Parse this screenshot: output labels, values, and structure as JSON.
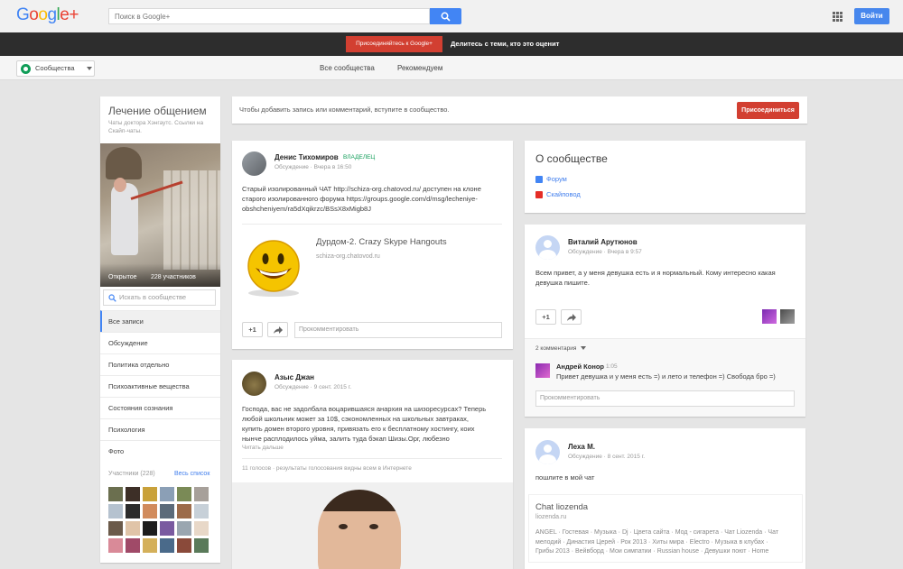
{
  "brand": {
    "name": "Google+"
  },
  "search": {
    "placeholder": "Поиск в Google+"
  },
  "header": {
    "login_label": "Войти"
  },
  "promo": {
    "join_label": "Присоединяйтесь к Google+",
    "text": "Делитесь с теми, кто это оценит"
  },
  "nav": {
    "communities_label": "Сообщества",
    "tabs": [
      {
        "label": "Все сообщества"
      },
      {
        "label": "Рекомендуем"
      }
    ]
  },
  "community": {
    "title": "Лечение общением",
    "subtitle": "Чаты доктора Хэнгаутс. Ссылки на Скайп-чаты.",
    "visibility": "Открытое",
    "members_count": "228 участников",
    "search_placeholder": "Искать в сообществе",
    "categories": [
      {
        "label": "Все записи"
      },
      {
        "label": "Обсуждение"
      },
      {
        "label": "Политика отдельно"
      },
      {
        "label": "Психоактивные вещества"
      },
      {
        "label": "Состояния сознания"
      },
      {
        "label": "Психология"
      },
      {
        "label": "Фото"
      }
    ],
    "members_header": "Участники (228)",
    "members_all": "Весь список",
    "member_colors": [
      "#6b6f4f",
      "#3d2f27",
      "#c9a13a",
      "#8b9fb6",
      "#7a8a56",
      "#a7a09a",
      "#b5c2cf",
      "#2c2c2c",
      "#d18b5c",
      "#5c6b7a",
      "#9c6b4a",
      "#c7d0d8",
      "#6b5a4a",
      "#e0c4a8",
      "#1d1d1d",
      "#7a5aa0",
      "#9aa6b0",
      "#e8d8c8",
      "#d98a98",
      "#a04a68",
      "#d4b05a",
      "#4a6a8a",
      "#8a4a3a",
      "#5a7a5a"
    ]
  },
  "joinbar": {
    "text": "Чтобы добавить запись или комментарий, вступите в сообщество.",
    "button": "Присоединиться"
  },
  "posts": {
    "p1": {
      "author": "Денис Тихомиров",
      "badge": "ВЛАДЕЛЕЦ",
      "category": "Обсуждение",
      "time": "Вчера в 16:50",
      "body_lines": [
        "Старый изолированный ЧАТ http://schiza-org.chatovod.ru/ доступен на клоне",
        "старого изолированного форума https://groups.google.com/d/msg/lecheniye-",
        "obshcheniyem/ra5dXqikrzc/BSsX8xMigb8J"
      ],
      "link_title": "Дурдом-2. Crazy Skype Hangouts",
      "link_url": "schiza-org.chatovod.ru",
      "plus": "+1",
      "comment_placeholder": "Прокомментировать"
    },
    "p2": {
      "author": "Азыс Джан",
      "category": "Обсуждение",
      "time": "9 сент. 2015 г.",
      "body_lines": [
        "Господа, вас не задолбала воцарившаяся анархия на шизоресурсах? Теперь",
        "любой школьник может за 10$, сэкономленных на школьных завтраках,",
        "купить домен второго уровня, привязать его к бесплатному хостингу, коих",
        "нынче расплодилось уйма, залить туда бэкап Шизы.Орг, любезно"
      ],
      "read_more": "Читать дальше",
      "votes": "11 голосов",
      "votes_note": "результаты голосования видны всем в Интернете"
    },
    "about": {
      "title": "О сообществе",
      "forum": "Форум",
      "skype": "Скайповод"
    },
    "p3": {
      "author": "Виталий Арутюнов",
      "category": "Обсуждение",
      "time": "Вчера в 9:57",
      "body_lines": [
        "Всем привет, а у меня девушка есть и я нормальный. Кому интересно какая",
        "девушка пишите."
      ],
      "plus": "+1",
      "comments_count": "2 комментария",
      "comment_author": "Андрей Конор",
      "comment_time": "1:05",
      "comment_text": "Привет девушка и у меня есть =) и лето и телефон =)  Свобода бро =)",
      "comment_placeholder": "Прокомментировать"
    },
    "p4": {
      "author": "Леха М.",
      "category": "Обсуждение",
      "time": "8 сент. 2015 г.",
      "body": "пошлите в мой чат",
      "link_title": "Chat liozenda",
      "link_url": "liozenda.ru",
      "link_lines": [
        "ANGEL · Гостевая · Музыка · Dj · Цвета сайта · Мод - сигарета · Чат Liozenda · Чат",
        "мелодий · Династия Церей · Рок 2013 · Хиты мира · Electro · Музыка в клубах ·",
        "Грибы 2013 · Вейвборд · Мои симпатии · Russian house · Девушки поют · Home"
      ]
    }
  },
  "colors": {
    "accent_blue": "#4285f4",
    "join_red": "#d23f31",
    "owner_green": "#109d58",
    "link_blue": "#427fed"
  }
}
